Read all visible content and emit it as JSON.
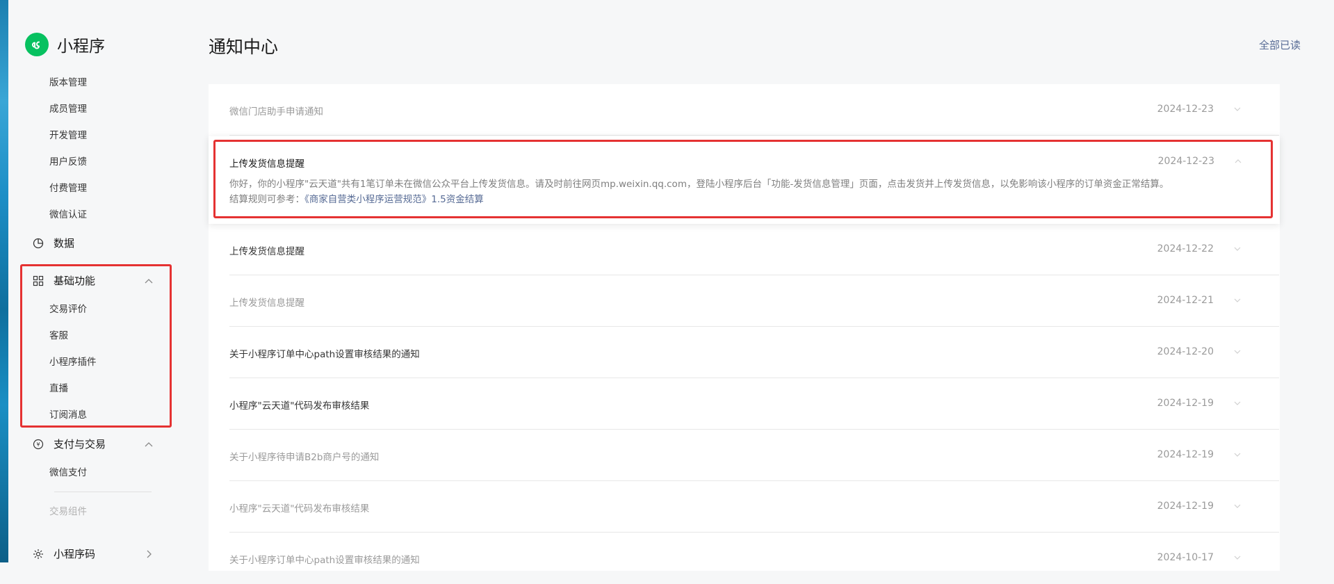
{
  "brand": {
    "name": "小程序",
    "color": "#07c160"
  },
  "header": {
    "title": "通知中心",
    "mark_all_read": "全部已读"
  },
  "sidebar": {
    "sub_items_top": [
      "版本管理",
      "成员管理",
      "开发管理",
      "用户反馈",
      "付费管理",
      "微信认证"
    ],
    "data_group": "数据",
    "basic_group": "基础功能",
    "basic_items": [
      "交易评价",
      "客服",
      "小程序插件",
      "直播",
      "订阅消息"
    ],
    "pay_group": "支付与交易",
    "pay_items": [
      "微信支付"
    ],
    "pay_disabled_item": "交易组件",
    "qrcode_group": "小程序码"
  },
  "notifications": [
    {
      "title": "微信门店助手申请通知",
      "date": "2024-12-23",
      "read": true
    },
    {
      "title": "上传发货信息提醒",
      "date": "2024-12-23",
      "read": false,
      "expanded": true,
      "body_line1": "你好，你的小程序\"云天道\"共有1笔订单未在微信公众平台上传发货信息。请及时前往网页mp.weixin.qq.com，登陆小程序后台「功能-发货信息管理」页面，点击发货并上传发货信息，以免影响该小程序的订单资金正常结算。",
      "body_line2_prefix": "结算规则可参考：",
      "body_line2_link": "《商家自营类小程序运营规范》1.5资金结算"
    },
    {
      "title": "上传发货信息提醒",
      "date": "2024-12-22",
      "read": false
    },
    {
      "title": "上传发货信息提醒",
      "date": "2024-12-21",
      "read": true
    },
    {
      "title": "关于小程序订单中心path设置审核结果的通知",
      "date": "2024-12-20",
      "read": false
    },
    {
      "title": "小程序\"云天道\"代码发布审核结果",
      "date": "2024-12-19",
      "read": false
    },
    {
      "title": "关于小程序待申请B2b商户号的通知",
      "date": "2024-12-19",
      "read": true
    },
    {
      "title": "小程序\"云天道\"代码发布审核结果",
      "date": "2024-12-19",
      "read": true
    },
    {
      "title": "关于小程序订单中心path设置审核结果的通知",
      "date": "2024-10-17",
      "read": true
    }
  ],
  "colors": {
    "highlight": "#e53232",
    "link": "#576b95"
  }
}
